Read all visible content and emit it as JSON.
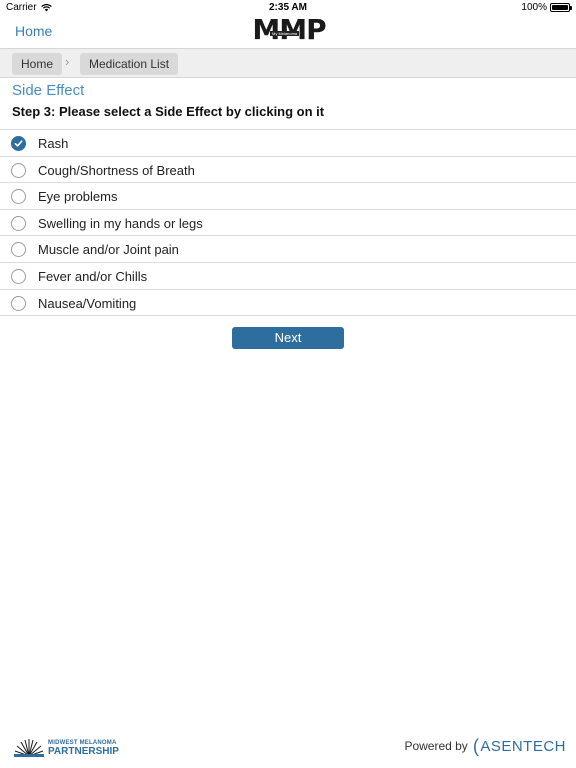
{
  "status_bar": {
    "carrier": "Carrier",
    "time": "2:35 AM",
    "battery": "100%",
    "battery_level": 1.0
  },
  "nav": {
    "home_label": "Home",
    "logo_text": "MMP",
    "logo_subtext": "My Melanoma"
  },
  "breadcrumb": {
    "items": [
      {
        "label": "Home"
      },
      {
        "label": "Medication List"
      }
    ],
    "separator": "›"
  },
  "page": {
    "section_title": "Side Effect",
    "step_title": "Step 3: Please select a Side Effect by clicking on it"
  },
  "options": [
    {
      "label": "Rash",
      "selected": true
    },
    {
      "label": "Cough/Shortness of Breath",
      "selected": false
    },
    {
      "label": "Eye problems",
      "selected": false
    },
    {
      "label": "Swelling in my hands or legs",
      "selected": false
    },
    {
      "label": "Muscle and/or Joint pain",
      "selected": false
    },
    {
      "label": "Fever and/or Chills",
      "selected": false
    },
    {
      "label": "Nausea/Vomiting",
      "selected": false
    }
  ],
  "next_label": "Next",
  "footer": {
    "partner_top": "MIDWEST MELANOMA",
    "partner_bottom": "PARTNERSHIP",
    "powered_label": "Powered by",
    "company": "ASENTECH"
  },
  "colors": {
    "accent": "#2e6e9e",
    "link": "#3a7fb5",
    "section_title": "#4a8cc0"
  },
  "icons": {
    "wifi": "wifi-icon",
    "battery": "battery-icon",
    "check": "check-icon",
    "chevron": "chevron-right-icon"
  }
}
